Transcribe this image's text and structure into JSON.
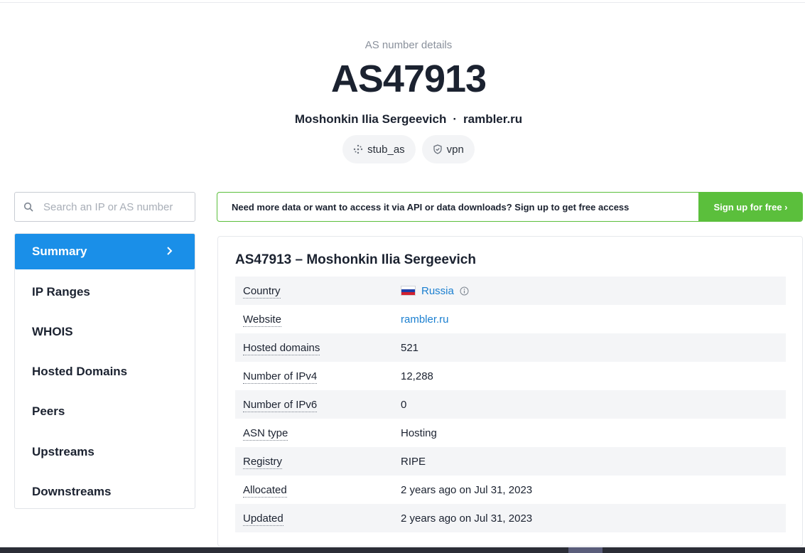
{
  "header": {
    "eyebrow": "AS number details",
    "title": "AS47913",
    "org": "Moshonkin Ilia Sergeevich",
    "separator": "·",
    "domain": "rambler.ru",
    "tags": [
      {
        "label": "stub_as",
        "icon": "network-dots-icon"
      },
      {
        "label": "vpn",
        "icon": "shield-check-icon"
      }
    ]
  },
  "search": {
    "placeholder": "Search an IP or AS number",
    "value": ""
  },
  "nav": {
    "items": [
      {
        "label": "Summary",
        "active": true
      },
      {
        "label": "IP Ranges"
      },
      {
        "label": "WHOIS"
      },
      {
        "label": "Hosted Domains"
      },
      {
        "label": "Peers"
      },
      {
        "label": "Upstreams"
      },
      {
        "label": "Downstreams"
      }
    ]
  },
  "banner": {
    "text": "Need more data or want to access it via API or data downloads? Sign up to get free access",
    "button": "Sign up for free ›",
    "color": "#5bbf3c"
  },
  "summary": {
    "title": "AS47913 – Moshonkin Ilia Sergeevich",
    "rows": [
      {
        "key": "Country",
        "value": "Russia"
      },
      {
        "key": "Website",
        "value": "rambler.ru"
      },
      {
        "key": "Hosted domains",
        "value": "521"
      },
      {
        "key": "Number of IPv4",
        "value": "12,288"
      },
      {
        "key": "Number of IPv6",
        "value": "0"
      },
      {
        "key": "ASN type",
        "value": "Hosting"
      },
      {
        "key": "Registry",
        "value": "RIPE"
      },
      {
        "key": "Allocated",
        "value": "2 years ago on Jul 31, 2023"
      },
      {
        "key": "Updated",
        "value": "2 years ago on Jul 31, 2023"
      }
    ]
  },
  "colors": {
    "accent": "#1a8fe8",
    "link": "#1a7fd0",
    "text": "#1b2230"
  }
}
